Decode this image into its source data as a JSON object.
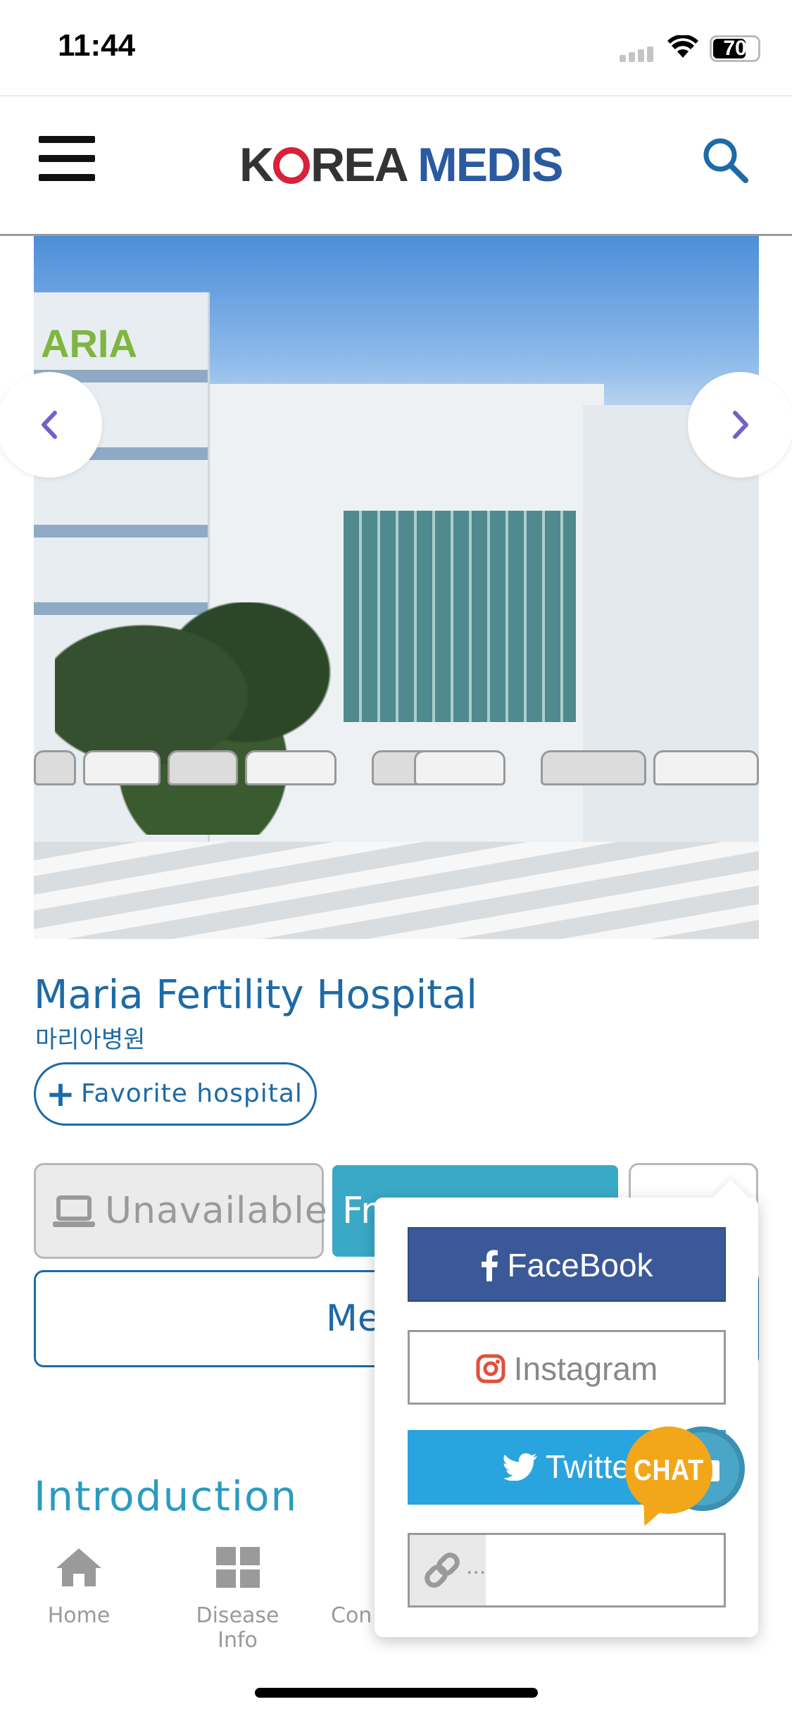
{
  "status_bar": {
    "time": "11:44",
    "battery_level": "70"
  },
  "header": {
    "logo_part1": "K",
    "logo_part2": "REA ",
    "logo_part3": "MEDIS"
  },
  "hero": {
    "building_sign": "ARIA"
  },
  "hospital": {
    "name": "Maria Fertility Hospital",
    "name_korean": "마리아병원",
    "favorite_label": "Favorite hospital"
  },
  "actions": {
    "unavailable_label": "Unavailable",
    "free_label": "Fr",
    "message_label": "Me"
  },
  "section": {
    "introduction": "Introduction"
  },
  "bottom_tabs": [
    {
      "label": "Home",
      "icon": "home-icon"
    },
    {
      "label": "Disease Info",
      "icon": "grid-icon"
    },
    {
      "label": "Con",
      "icon": ""
    }
  ],
  "share_menu": {
    "facebook_label": "FaceBook",
    "instagram_label": "Instagram",
    "twitter_label": "Twitte",
    "link_placeholder": "..."
  },
  "chat": {
    "label": "CHAT"
  },
  "colors": {
    "brand_blue": "#1d6aa6",
    "teal": "#3aa9c8",
    "facebook": "#3b5998",
    "twitter": "#29a4de",
    "instagram_icon": "#e1503a",
    "chat_yellow": "#f2a71a",
    "arrow_purple": "#6f62c8"
  }
}
